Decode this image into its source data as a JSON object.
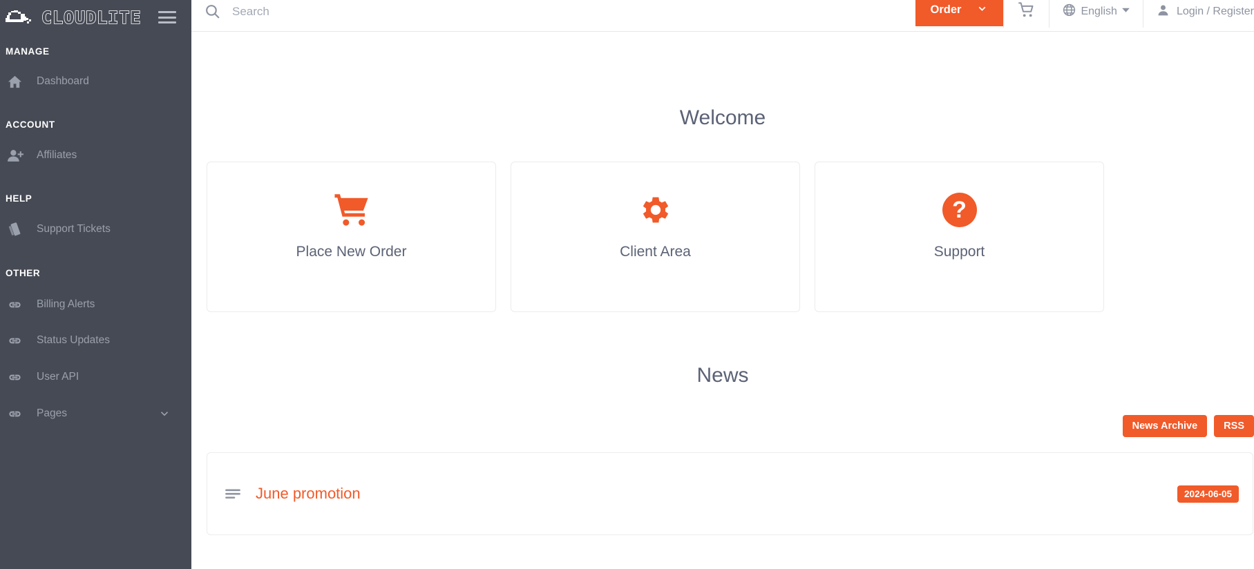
{
  "brand": {
    "logo_text": "CLOUDLITE",
    "accent_color": "#F15A29",
    "sidebar_color": "#464A54"
  },
  "sidebar": {
    "menu_toggle": "menu-toggle",
    "sections": [
      {
        "title": "MANAGE",
        "items": [
          {
            "label": "Dashboard",
            "icon": "home-icon"
          }
        ]
      },
      {
        "title": "ACCOUNT",
        "items": [
          {
            "label": "Affiliates",
            "icon": "user-plus-icon"
          }
        ]
      },
      {
        "title": "HELP",
        "items": [
          {
            "label": "Support Tickets",
            "icon": "tickets-icon"
          }
        ]
      },
      {
        "title": "OTHER",
        "items": [
          {
            "label": "Billing Alerts",
            "icon": "link-icon"
          },
          {
            "label": "Status Updates",
            "icon": "link-icon"
          },
          {
            "label": "User API",
            "icon": "link-icon"
          },
          {
            "label": "Pages",
            "icon": "link-icon",
            "expandable": true
          }
        ]
      }
    ]
  },
  "header": {
    "search_placeholder": "Search",
    "search_value": "",
    "order_label": "Order",
    "cart_icon": "cart-icon",
    "language": "English",
    "account_label": "Login / Register"
  },
  "main": {
    "welcome_title": "Welcome",
    "cards": [
      {
        "label": "Place New Order",
        "icon": "cart-icon"
      },
      {
        "label": "Client Area",
        "icon": "gear-icon"
      },
      {
        "label": "Support",
        "icon": "question-circle-icon"
      }
    ],
    "news": {
      "title": "News",
      "archive_label": "News Archive",
      "rss_label": "RSS",
      "items": [
        {
          "headline": "June promotion",
          "date": "2024-06-05"
        }
      ]
    }
  }
}
